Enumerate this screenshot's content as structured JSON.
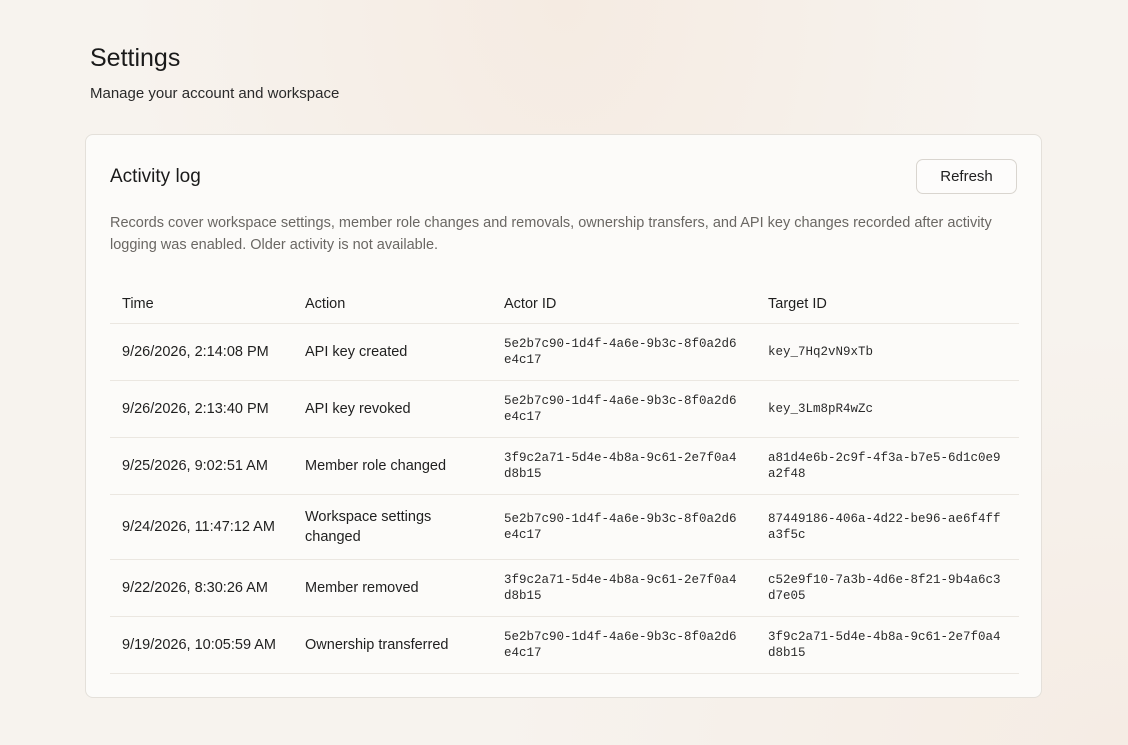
{
  "header": {
    "title": "Settings",
    "subtitle": "Manage your account and workspace"
  },
  "activity_log": {
    "title": "Activity log",
    "refresh_label": "Refresh",
    "description": "Records cover workspace settings, member role changes and removals, ownership transfers, and API key changes recorded after activity logging was enabled. Older activity is not available.",
    "columns": {
      "time": "Time",
      "action": "Action",
      "actor_id": "Actor ID",
      "target_id": "Target ID"
    },
    "rows": [
      {
        "time": "9/26/2026, 2:14:08 PM",
        "action": "API key created",
        "actor_id": "5e2b7c90-1d4f-4a6e-9b3c-8f0a2d6e4c17",
        "target_id": "key_7Hq2vN9xTb"
      },
      {
        "time": "9/26/2026, 2:13:40 PM",
        "action": "API key revoked",
        "actor_id": "5e2b7c90-1d4f-4a6e-9b3c-8f0a2d6e4c17",
        "target_id": "key_3Lm8pR4wZc"
      },
      {
        "time": "9/25/2026, 9:02:51 AM",
        "action": "Member role changed",
        "actor_id": "3f9c2a71-5d4e-4b8a-9c61-2e7f0a4d8b15",
        "target_id": "a81d4e6b-2c9f-4f3a-b7e5-6d1c0e9a2f48"
      },
      {
        "time": "9/24/2026, 11:47:12 AM",
        "action": "Workspace settings changed",
        "actor_id": "5e2b7c90-1d4f-4a6e-9b3c-8f0a2d6e4c17",
        "target_id": "87449186-406a-4d22-be96-ae6f4ffa3f5c"
      },
      {
        "time": "9/22/2026, 8:30:26 AM",
        "action": "Member removed",
        "actor_id": "3f9c2a71-5d4e-4b8a-9c61-2e7f0a4d8b15",
        "target_id": "c52e9f10-7a3b-4d6e-8f21-9b4a6c3d7e05"
      },
      {
        "time": "9/19/2026, 10:05:59 AM",
        "action": "Ownership transferred",
        "actor_id": "5e2b7c90-1d4f-4a6e-9b3c-8f0a2d6e4c17",
        "target_id": "3f9c2a71-5d4e-4b8a-9c61-2e7f0a4d8b15"
      }
    ]
  }
}
